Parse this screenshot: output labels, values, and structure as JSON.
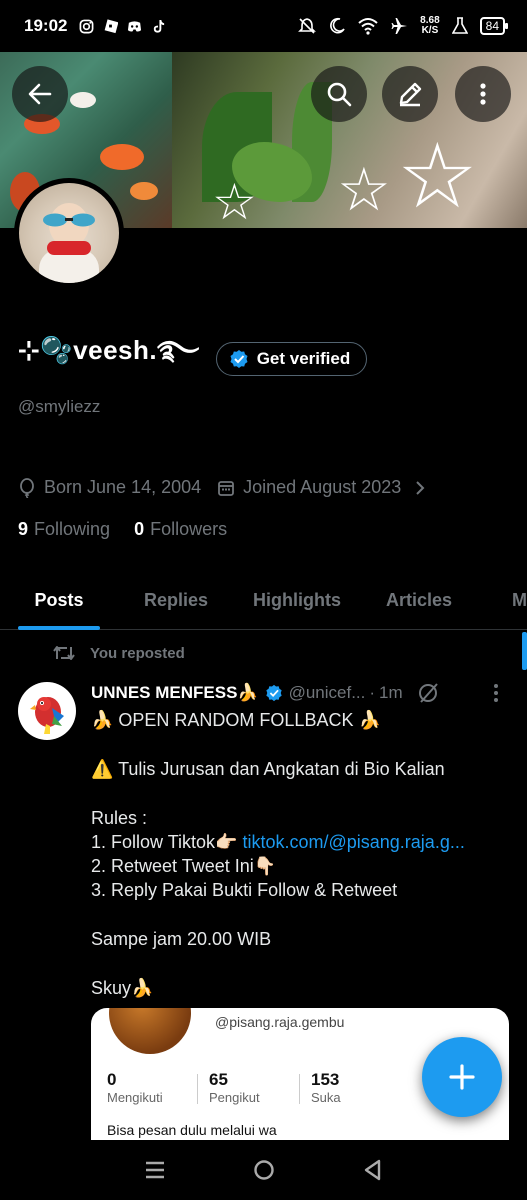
{
  "status_bar": {
    "time": "19:02",
    "net_speed_value": "8.68",
    "net_speed_unit": "K/S",
    "battery": "84",
    "left_icons": [
      "instagram-icon",
      "roblox-icon",
      "discord-icon",
      "tiktok-icon"
    ],
    "right_icons": [
      "mute-icon",
      "do-not-disturb-icon",
      "wifi-icon",
      "airplane-icon",
      "lab-icon",
      "battery-icon"
    ]
  },
  "header": {
    "back_icon": "arrow-left-icon",
    "search_icon": "search-icon",
    "edit_icon": "pencil-icon",
    "more_icon": "more-vertical-icon"
  },
  "profile": {
    "display_name": "⊹🫧veesh.࿐",
    "verify_label": "Get verified",
    "handle": "@smyliezz",
    "born": "Born June 14, 2004",
    "joined": "Joined August 2023",
    "following_count": "9",
    "following_label": "Following",
    "followers_count": "0",
    "followers_label": "Followers"
  },
  "tabs": [
    {
      "label": "Posts",
      "active": true
    },
    {
      "label": "Replies",
      "active": false
    },
    {
      "label": "Highlights",
      "active": false
    },
    {
      "label": "Articles",
      "active": false
    },
    {
      "label": "M",
      "active": false
    }
  ],
  "post": {
    "repost_label": "You reposted",
    "author_name": "UNNES MENFESS🍌",
    "author_handle": "@unicef...",
    "time_sep": "·",
    "time": "1m",
    "lines": [
      "🍌 OPEN RANDOM FOLLBACK 🍌",
      "",
      "⚠️ Tulis Jurusan dan Angkatan di Bio Kalian",
      "",
      "Rules :",
      "1. Follow Tiktok👉🏻",
      "2. Retweet Tweet Ini👇🏻",
      "3. Reply Pakai Bukti Follow & Retweet",
      "",
      "Sampe jam 20.00 WIB",
      "",
      "Skuy🍌"
    ],
    "link": "tiktok.com/@pisang.raja.g..."
  },
  "media_card": {
    "handle": "@pisang.raja.gembu",
    "stats": [
      {
        "value": "0",
        "label": "Mengikuti"
      },
      {
        "value": "65",
        "label": "Pengikut"
      },
      {
        "value": "153",
        "label": "Suka"
      }
    ],
    "description": "Bisa pesan dulu melalui wa"
  },
  "fab": {
    "icon": "plus-icon"
  },
  "nav": {
    "icons": [
      "recents-icon",
      "home-icon",
      "back-icon"
    ]
  },
  "colors": {
    "accent": "#1d9bf0",
    "background": "#000000",
    "muted": "#71767b"
  }
}
